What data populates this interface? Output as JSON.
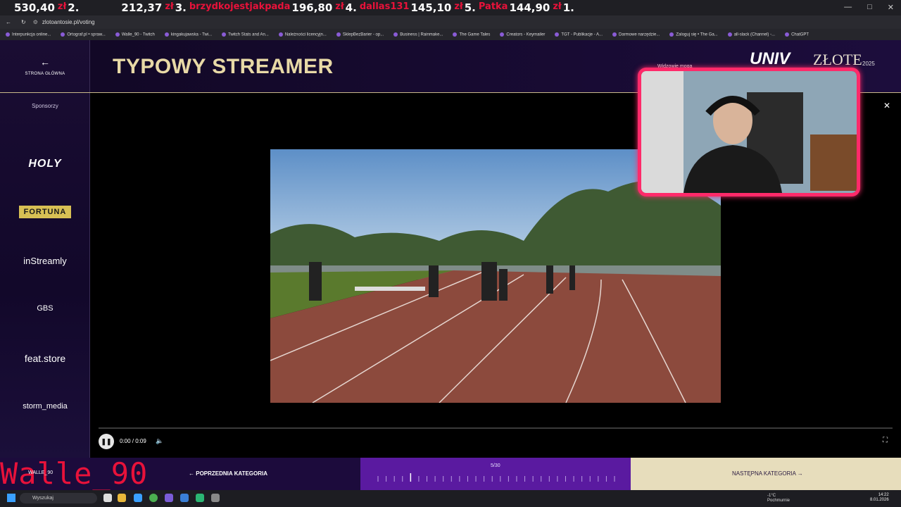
{
  "ticker": [
    {
      "amount": "530,40",
      "unit": "zł",
      "rank": "2."
    },
    {
      "amount": "212,37",
      "unit": "zł",
      "rank": "3."
    },
    {
      "name": "brzydkojestjakpada",
      "amount": "196,80",
      "unit": "zł",
      "rank": "4."
    },
    {
      "name": "dallas131",
      "amount": "145,10",
      "unit": "zł",
      "rank": "5."
    },
    {
      "name": "Patka",
      "amount": "144,90",
      "unit": "zł",
      "rank": "1."
    }
  ],
  "browser": {
    "url": "zlotoantosie.pl/voting",
    "bookmarks": [
      "Interpunkcja online...",
      "Ortograf.pl • spraw...",
      "Walle_90 - Twitch",
      "kingakujawska - Twi...",
      "Twitch Stats and An...",
      "Należności licencyjn...",
      "SklepBezBarier - op...",
      "Business | Rainmake...",
      "The Game Tales",
      "Creators - Keymailer",
      "TGT - Publikacje - A...",
      "Darmowe narzędzie...",
      "Zaloguj się • The Ga...",
      "all-slack (Channel) -...",
      "ChatGPT"
    ]
  },
  "sidebar": {
    "home_label": "STRONA GŁÓWNA",
    "sponsors_title": "Sponsorzy",
    "sponsors": [
      "HOLY",
      "FORTUNA",
      "inStreamly",
      "GBS",
      "feat.store",
      "storm_media"
    ]
  },
  "header": {
    "title": "TYPOWY STREAMER",
    "viewers_label": "Widzowie mogą",
    "logo_a": "UNIV",
    "logo_b": "ZŁOTE",
    "logo_c": "2025"
  },
  "player": {
    "time": "0:00 / 0:09",
    "progress": 0
  },
  "bottom": {
    "prev_label": "POPRZEDNIA KATEGORIA",
    "counter": "5/30",
    "next_label": "NASTĘPNA KATEGORIA",
    "overlay_name": "Walle_90",
    "overlay_small": "WALLE_90"
  },
  "taskbar": {
    "search_placeholder": "Wyszukaj",
    "weather_temp": "-1°C",
    "weather_desc": "Pochmurnie",
    "time": "14:22",
    "date": "8.01.2026"
  },
  "colors": {
    "accent": "#e8d9a6",
    "brand_purple": "#5a1aa0",
    "overlay_red": "#e8123a",
    "cam_border": "#ff2a6a"
  }
}
